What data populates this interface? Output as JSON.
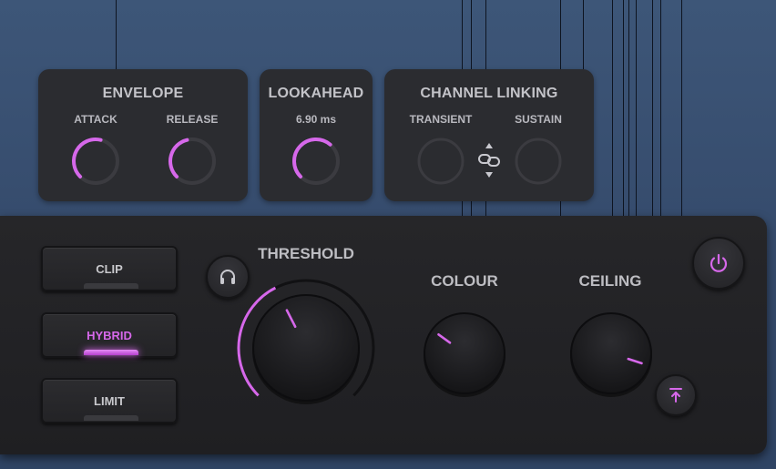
{
  "colors": {
    "accent": "#d668ea",
    "panel_bg": "#2b2c30",
    "main_bg": "#222225",
    "track": "#3b3b40",
    "background": "#3a5375"
  },
  "envelope": {
    "title": "ENVELOPE",
    "attack": {
      "label": "ATTACK",
      "level": 0.55
    },
    "release": {
      "label": "RELEASE",
      "level": 0.45
    }
  },
  "lookahead": {
    "title": "LOOKAHEAD",
    "value_text": "6.90 ms",
    "level": 0.65
  },
  "channel_linking": {
    "title": "CHANNEL LINKING",
    "transient": {
      "label": "TRANSIENT",
      "level": 0
    },
    "sustain": {
      "label": "SUSTAIN",
      "level": 0
    },
    "link_icon": "link-icon",
    "arrows_icon": "up-down-arrows-icon"
  },
  "modes": [
    {
      "label": "CLIP",
      "active": false
    },
    {
      "label": "HYBRID",
      "active": true
    },
    {
      "label": "LIMIT",
      "active": false
    }
  ],
  "threshold": {
    "title": "THRESHOLD",
    "level": 0.4
  },
  "colour": {
    "title": "COLOUR",
    "level": 0.3
  },
  "ceiling": {
    "title": "CEILING",
    "level": 0.9
  },
  "icons": {
    "listen": "headphones-icon",
    "power": "power-icon",
    "ceiling_link": "arrow-up-to-line-icon"
  }
}
